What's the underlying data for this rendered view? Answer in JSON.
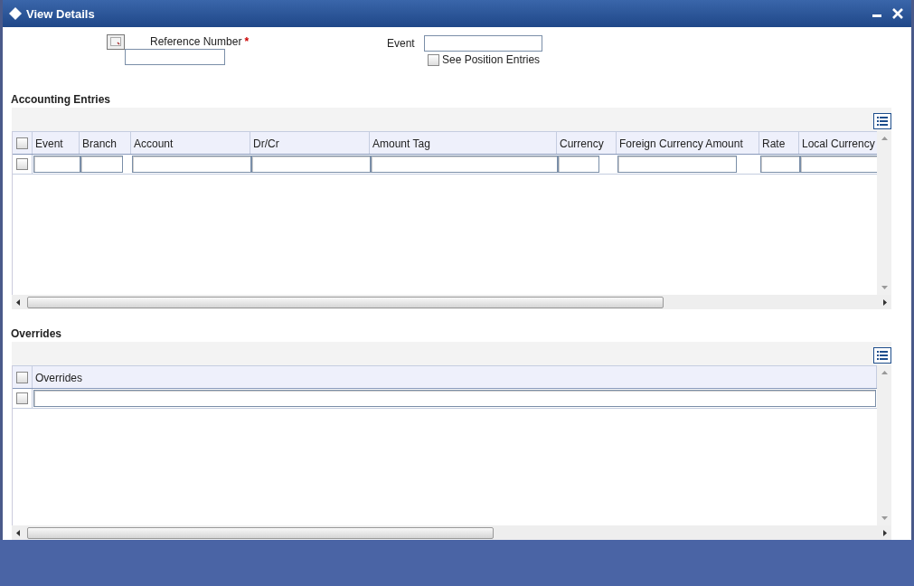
{
  "window": {
    "title": "View Details"
  },
  "form": {
    "reference_number": {
      "label": "Reference Number",
      "required_mark": "*"
    },
    "event": {
      "label": "Event"
    },
    "see_position_entries": {
      "label": "See Position Entries",
      "checked": false
    }
  },
  "accounting_entries": {
    "title": "Accounting Entries",
    "select_all_checked": false,
    "columns": [
      "Event",
      "Branch",
      "Account",
      "Dr/Cr",
      "Amount Tag",
      "Currency",
      "Foreign Currency Amount",
      "Rate",
      "Local Currency"
    ],
    "rows": [
      {
        "checked": false
      }
    ]
  },
  "overrides": {
    "title": "Overrides",
    "select_all_checked": false,
    "columns": [
      "Overrides"
    ],
    "rows": [
      {
        "checked": false
      }
    ]
  }
}
